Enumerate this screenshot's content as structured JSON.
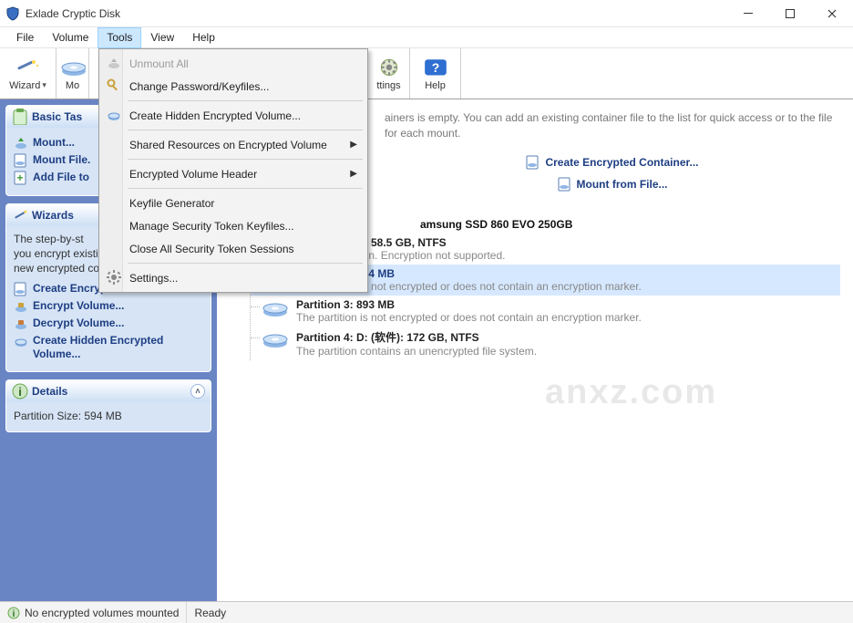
{
  "app": {
    "title": "Exlade Cryptic Disk"
  },
  "menubar": {
    "items": [
      "File",
      "Volume",
      "Tools",
      "View",
      "Help"
    ],
    "selected_index": 2
  },
  "toolbar": {
    "wizard": "Wizard",
    "mo_trunc": "Mo",
    "settings_trunc": "ttings",
    "help": "Help"
  },
  "sidebar": {
    "basic": {
      "title_trunc": "Basic Tas",
      "items": [
        "Mount...",
        "Mount File.",
        "Add File to"
      ]
    },
    "wizards": {
      "title": "Wizards",
      "desc_trunc": "The step-by-st",
      "desc_rest": "you encrypt existing volumes or create new encrypted containers.",
      "items": [
        "Create Encrypted Container...",
        "Encrypt Volume...",
        "Decrypt Volume...",
        "Create Hidden Encrypted Volume..."
      ]
    },
    "details": {
      "title": "Details",
      "rows": [
        "Partition Size: 594 MB"
      ]
    }
  },
  "dropdown": {
    "items": [
      {
        "label": "Unmount All",
        "icon": "unmount-all-icon",
        "disabled": true
      },
      {
        "label": "Change Password/Keyfiles...",
        "icon": "key-icon"
      },
      {
        "sep": true
      },
      {
        "label": "Create Hidden Encrypted Volume...",
        "icon": "hidden-vol-icon"
      },
      {
        "sep": true
      },
      {
        "label": "Shared Resources on Encrypted Volume",
        "submenu": true
      },
      {
        "sep": true
      },
      {
        "label": "Encrypted Volume Header",
        "submenu": true
      },
      {
        "sep": true
      },
      {
        "label": "Keyfile Generator"
      },
      {
        "label": "Manage Security Token Keyfiles..."
      },
      {
        "label": "Close All Security Token Sessions"
      },
      {
        "sep": true
      },
      {
        "label": "Settings...",
        "icon": "gear-icon"
      }
    ]
  },
  "content": {
    "hint_partial": "ainers is empty. You can add an existing container file to the list for quick access or to the file for each mount.",
    "link_create": "Create Encrypted Container...",
    "link_mount": "Mount from File...",
    "disk_root_trunc": "amsung SSD 860 EVO 250GB",
    "partitions": [
      {
        "title": "Partition 1: C: 58.5 GB, NTFS",
        "sub": "System partition. Encryption not supported.",
        "selected": false
      },
      {
        "title": "Partition 2: 594 MB",
        "sub": "The partition is not encrypted or does not contain an encryption marker.",
        "selected": true
      },
      {
        "title": "Partition 3: 893 MB",
        "sub": "The partition is not encrypted or does not contain an encryption marker.",
        "selected": false
      },
      {
        "title": "Partition 4: D: (软件): 172 GB, NTFS",
        "sub": "The partition contains an unencrypted file system.",
        "selected": false
      }
    ]
  },
  "statusbar": {
    "left": "No encrypted volumes mounted",
    "ready": "Ready"
  },
  "watermark": "anxz.com",
  "colors": {
    "accent": "#1e3e82",
    "sidebar_bg": "#6985c4",
    "panel_bg": "#d6e4f6",
    "sel_bg": "#d6e8ff"
  }
}
